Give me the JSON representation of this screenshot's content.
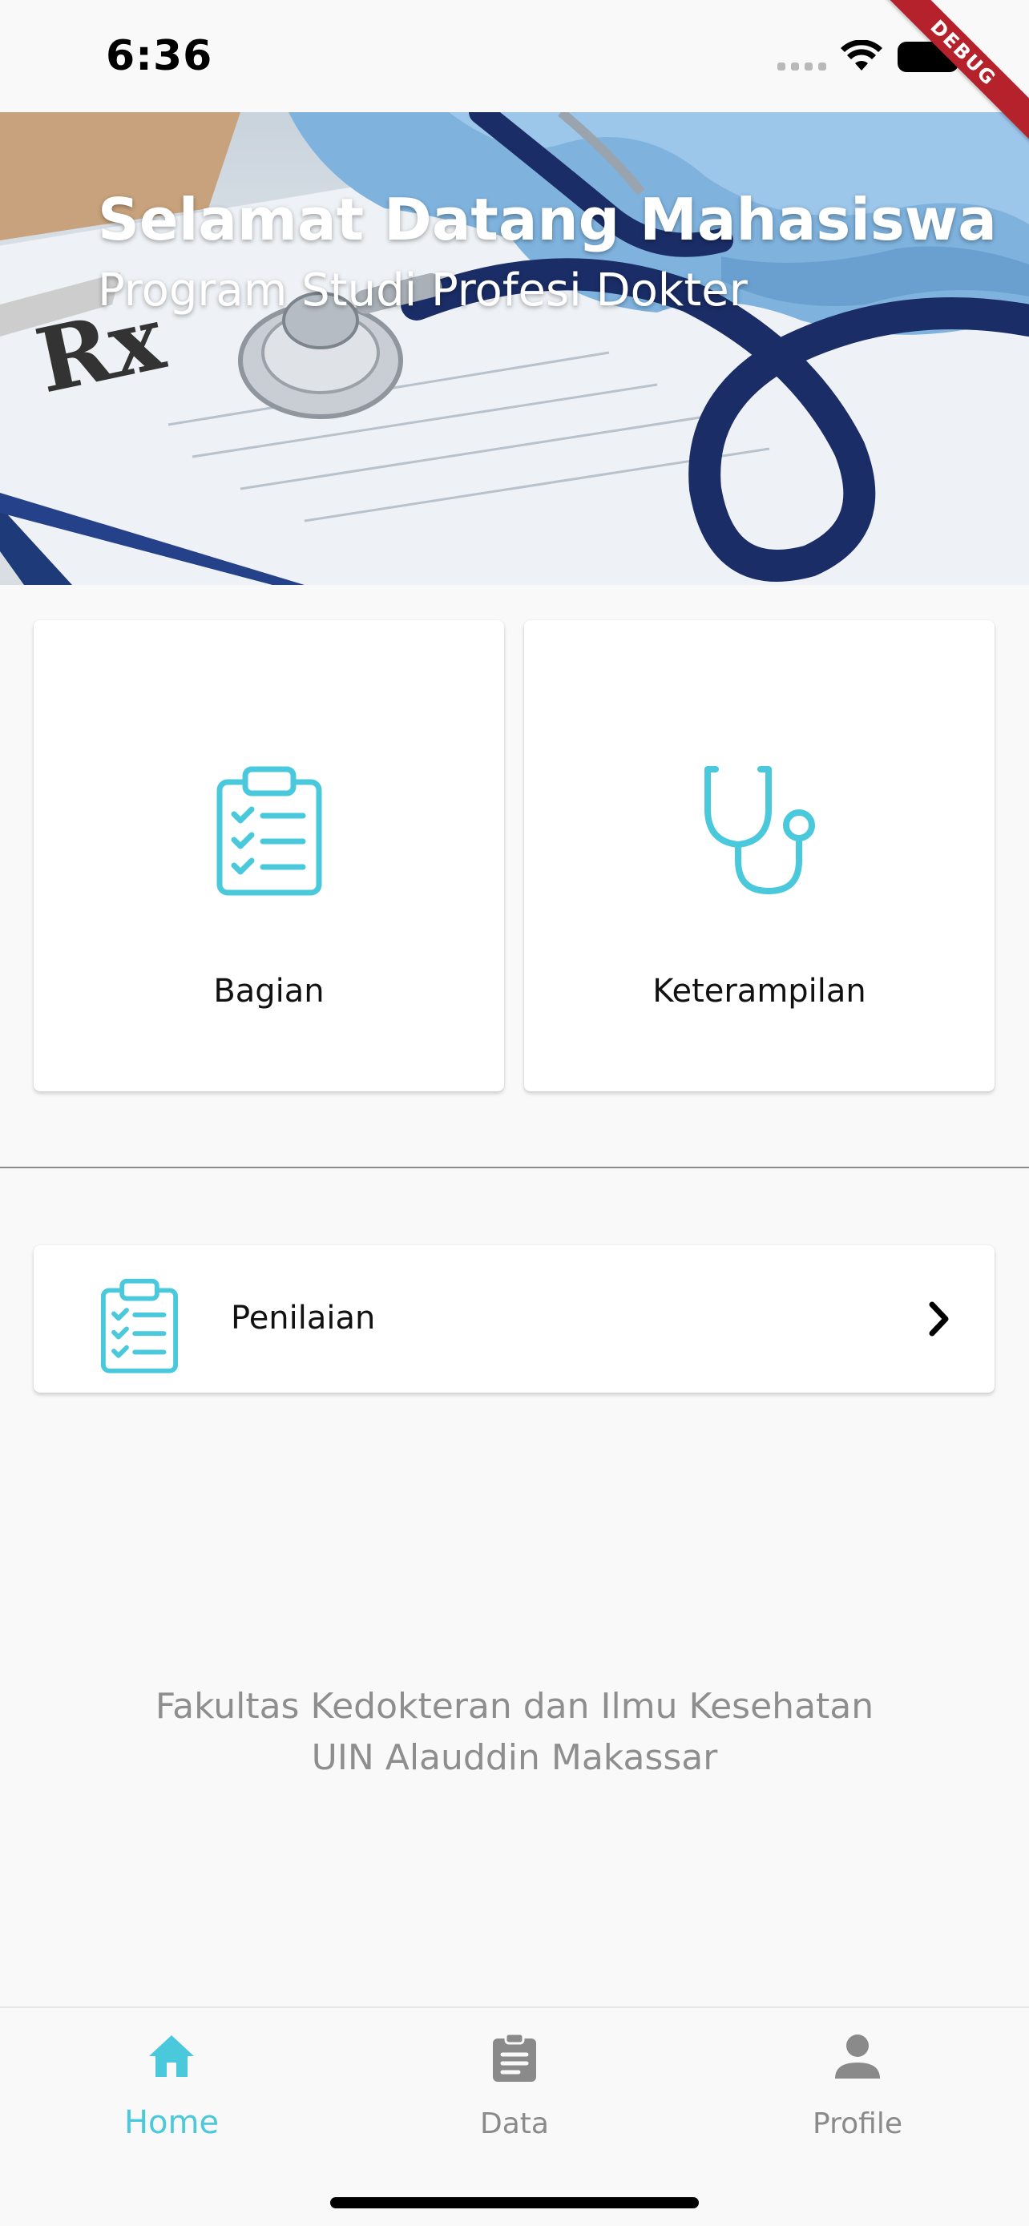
{
  "status_bar": {
    "time": "6:36",
    "debug_label": "DEBUG",
    "icons": [
      "signal-icon",
      "wifi-icon",
      "battery-icon"
    ]
  },
  "hero": {
    "title": "Selamat Datang Mahasiswa",
    "subtitle": "Program Studi Profesi Dokter"
  },
  "menu": {
    "cards": [
      {
        "label": "Bagian",
        "icon": "clipboard-checklist-icon"
      },
      {
        "label": "Keterampilan",
        "icon": "stethoscope-icon"
      }
    ],
    "list": [
      {
        "label": "Penilaian",
        "icon": "clipboard-checklist-icon",
        "trailing_icon": "chevron-right-icon"
      }
    ]
  },
  "footer": {
    "line1": "Fakultas Kedokteran dan Ilmu Kesehatan",
    "line2": "UIN Alauddin Makassar"
  },
  "bottom_nav": {
    "active": "Home",
    "items": [
      {
        "label": "Home",
        "icon": "home-icon"
      },
      {
        "label": "Data",
        "icon": "clipboard-icon"
      },
      {
        "label": "Profile",
        "icon": "person-icon"
      }
    ]
  },
  "colors": {
    "accent": "#4ac9dc",
    "background": "#f9f9f9",
    "muted_text": "#8e8e8e",
    "debug_ribbon": "#b5222c"
  }
}
